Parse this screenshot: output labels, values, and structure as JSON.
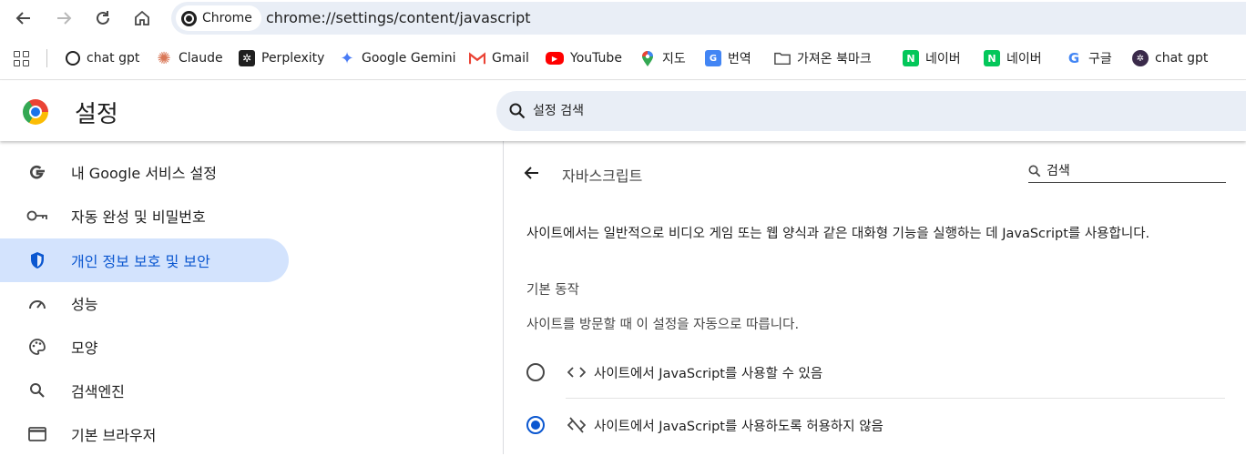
{
  "browser": {
    "chip_label": "Chrome",
    "url": "chrome://settings/content/javascript"
  },
  "bookmarks": [
    {
      "label": "chat gpt",
      "icon": "openai-icon"
    },
    {
      "label": "Claude",
      "icon": "claude-icon"
    },
    {
      "label": "Perplexity",
      "icon": "perplexity-icon"
    },
    {
      "label": "Google Gemini",
      "icon": "gemini-icon"
    },
    {
      "label": "Gmail",
      "icon": "gmail-icon"
    },
    {
      "label": "YouTube",
      "icon": "youtube-icon"
    },
    {
      "label": "지도",
      "icon": "maps-icon"
    },
    {
      "label": "번역",
      "icon": "translate-icon"
    },
    {
      "label": "가져온 북마크",
      "icon": "folder-icon"
    },
    {
      "label": "네이버",
      "icon": "naver-icon"
    },
    {
      "label": "네이버",
      "icon": "naver-icon"
    },
    {
      "label": "구글",
      "icon": "google-icon"
    },
    {
      "label": "chat gpt",
      "icon": "openai-icon"
    }
  ],
  "settings": {
    "title": "설정",
    "search_placeholder": "설정 검색"
  },
  "sidebar": {
    "items": [
      {
        "label": "내 Google 서비스 설정",
        "icon": "google-g-icon",
        "active": false
      },
      {
        "label": "자동 완성 및 비밀번호",
        "icon": "key-icon",
        "active": false
      },
      {
        "label": "개인 정보 보호 및 보안",
        "icon": "shield-icon",
        "active": true
      },
      {
        "label": "성능",
        "icon": "gauge-icon",
        "active": false
      },
      {
        "label": "모양",
        "icon": "palette-icon",
        "active": false
      },
      {
        "label": "검색엔진",
        "icon": "search-icon",
        "active": false
      },
      {
        "label": "기본 브라우저",
        "icon": "browser-window-icon",
        "active": false
      }
    ]
  },
  "main": {
    "title": "자바스크립트",
    "search_placeholder": "검색",
    "description": "사이트에서는 일반적으로 비디오 게임 또는 웹 양식과 같은 대화형 기능을 실행하는 데 JavaScript를 사용합니다.",
    "default_behavior_title": "기본 동작",
    "default_behavior_sub": "사이트를 방문할 때 이 설정을 자동으로 따릅니다.",
    "options": [
      {
        "label": "사이트에서 JavaScript를 사용할 수 있음",
        "icon": "code-icon",
        "checked": false
      },
      {
        "label": "사이트에서 JavaScript를 사용하도록 허용하지 않음",
        "icon": "code-off-icon",
        "checked": true
      }
    ]
  },
  "colors": {
    "accent": "#0b57d0",
    "active_bg": "#d3e3fd",
    "omnibox_bg": "#e9eef6"
  }
}
